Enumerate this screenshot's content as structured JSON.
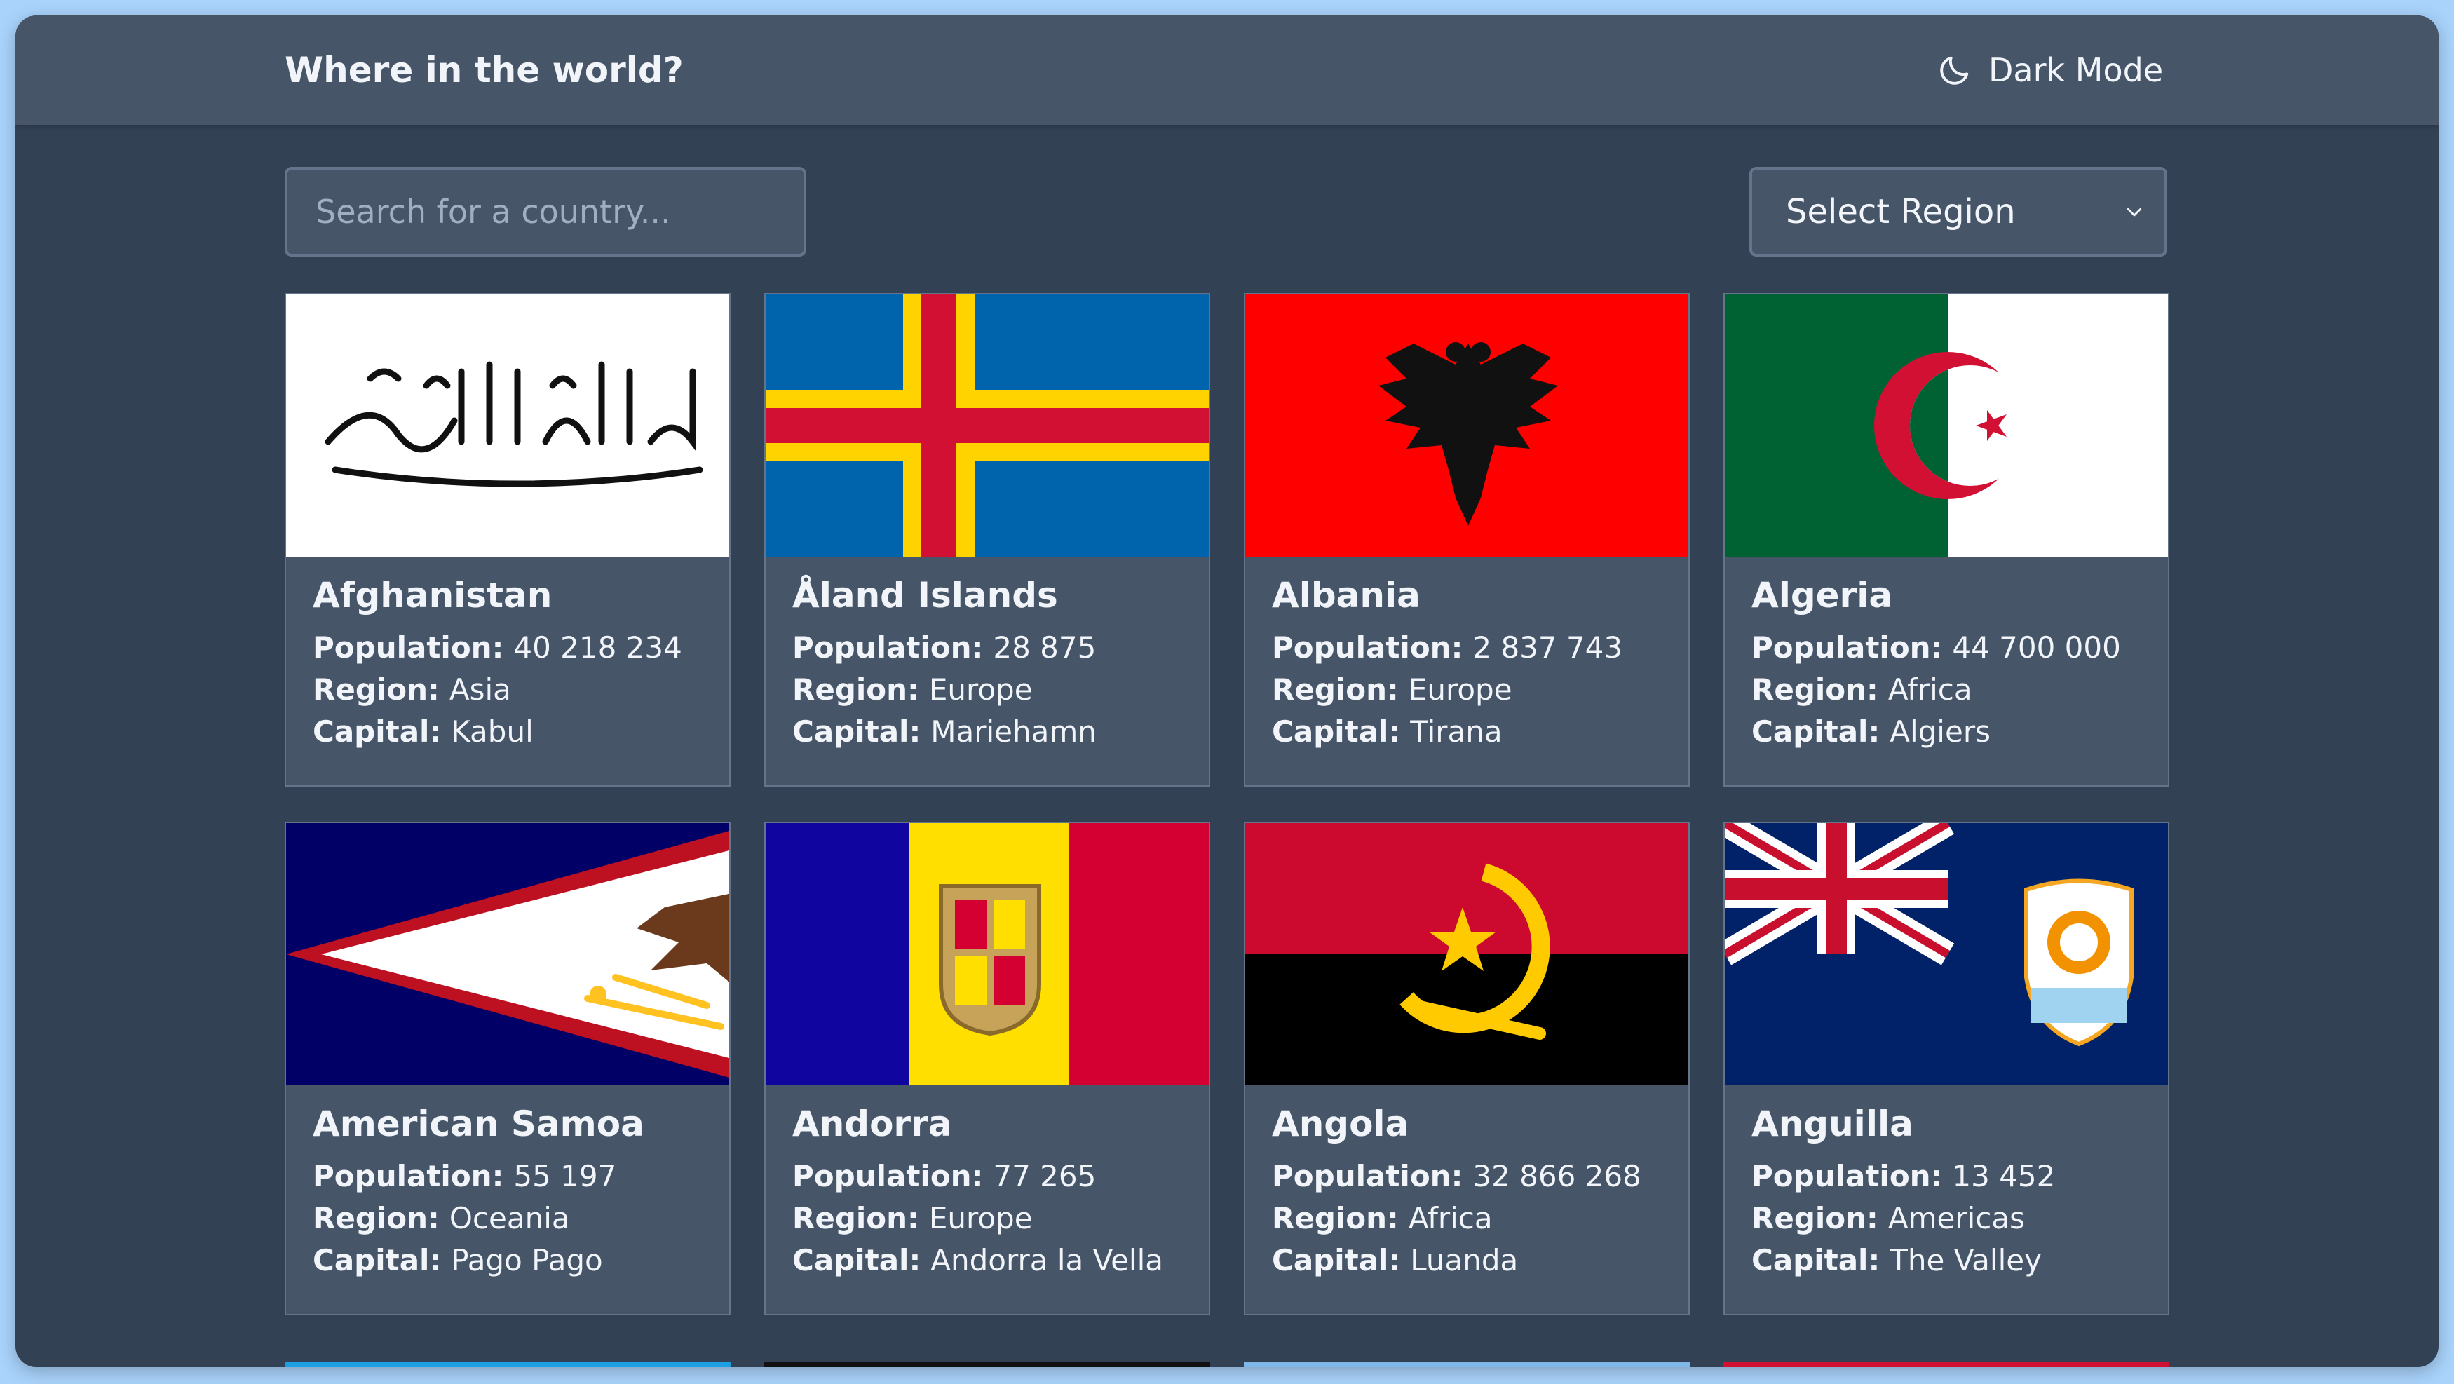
{
  "header": {
    "title": "Where in the world?",
    "mode_label": "Dark Mode",
    "mode_icon": "moon-icon"
  },
  "search": {
    "placeholder": "Search for a country..."
  },
  "filter": {
    "label": "Select Region",
    "icon": "chevron-down-icon"
  },
  "field_labels": {
    "population": "Population:",
    "region": "Region:",
    "capital": "Capital:"
  },
  "countries": [
    {
      "name": "Afghanistan",
      "population": "40 218 234",
      "region": "Asia",
      "capital": "Kabul"
    },
    {
      "name": "Åland Islands",
      "population": "28 875",
      "region": "Europe",
      "capital": "Mariehamn"
    },
    {
      "name": "Albania",
      "population": "2 837 743",
      "region": "Europe",
      "capital": "Tirana"
    },
    {
      "name": "Algeria",
      "population": "44 700 000",
      "region": "Africa",
      "capital": "Algiers"
    },
    {
      "name": "American Samoa",
      "population": "55 197",
      "region": "Oceania",
      "capital": "Pago Pago"
    },
    {
      "name": "Andorra",
      "population": "77 265",
      "region": "Europe",
      "capital": "Andorra la Vella"
    },
    {
      "name": "Angola",
      "population": "32 866 268",
      "region": "Africa",
      "capital": "Luanda"
    },
    {
      "name": "Anguilla",
      "population": "13 452",
      "region": "Americas",
      "capital": "The Valley"
    }
  ],
  "colors": {
    "background": "#334155",
    "header": "#475569",
    "card": "#475569",
    "text": "#f1f5f9",
    "outer": "#a9d3fb"
  }
}
